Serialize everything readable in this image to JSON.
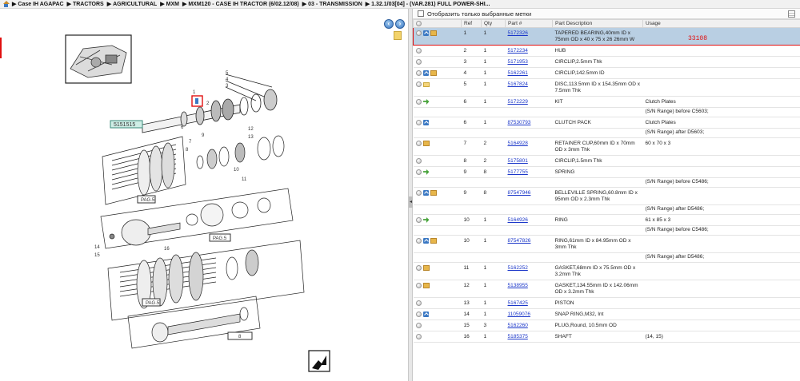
{
  "breadcrumb": {
    "items": [
      "Case IH AGAPAC",
      "TRACTORS",
      "AGRICULTURAL",
      "MXM",
      "MXM120 - CASE IH TRACTOR (6/02.12/08)",
      "03 - TRANSMISSION",
      "1.32.1/03[04] - (VAR.281) FULL POWER-SHI..."
    ],
    "separator": "▶"
  },
  "diagram": {
    "callout_label": "5151515",
    "page_labels": [
      "PAG.5",
      "PAG.5",
      "PAG.5"
    ],
    "bottom_label": "8",
    "numbers": [
      "1",
      "2",
      "3",
      "4",
      "5",
      "6",
      "7",
      "8",
      "9",
      "10",
      "11",
      "12",
      "13",
      "14",
      "15",
      "16"
    ]
  },
  "filter": {
    "label": "Отобразить только выбранные метки",
    "checked": false
  },
  "table": {
    "headers": [
      "",
      "Ref",
      "Qty",
      "Part #",
      "Part Description",
      "Usage"
    ],
    "highlight_code": "33108",
    "rows": [
      {
        "icons": [
          "info",
          "box"
        ],
        "ref": "1",
        "qty": "1",
        "part": "5172326",
        "desc": "TAPERED BEARING,40mm ID x 75mm OD x 40 x 75 x 26 26mm W",
        "usage": "",
        "selected": true
      },
      {
        "icons": [],
        "ref": "2",
        "qty": "1",
        "part": "5172234",
        "desc": "HUB",
        "usage": ""
      },
      {
        "icons": [],
        "ref": "3",
        "qty": "1",
        "part": "5171953",
        "desc": "CIRCLIP,2.5mm Thk",
        "usage": ""
      },
      {
        "icons": [
          "info",
          "box"
        ],
        "ref": "4",
        "qty": "1",
        "part": "5162261",
        "desc": "CIRCLIP,142.5mm ID",
        "usage": ""
      },
      {
        "icons": [
          "folder"
        ],
        "ref": "5",
        "qty": "1",
        "part": "5167824",
        "desc": "DISC,113.5mm ID x 154.35mm OD x 7.5mm Thk",
        "usage": ""
      },
      {
        "icons": [
          "arrow"
        ],
        "ref": "6",
        "qty": "1",
        "part": "5172229",
        "desc": "KIT",
        "usage": "Clutch Plates"
      },
      {
        "sub": true,
        "usage": "(S/N Range) before C5603;"
      },
      {
        "icons": [
          "info"
        ],
        "ref": "6",
        "qty": "1",
        "part": "87530793",
        "desc": "CLUTCH PACK",
        "usage": "Clutch Plates"
      },
      {
        "sub": true,
        "usage": "(S/N Range) after D5603;"
      },
      {
        "icons": [
          "box"
        ],
        "ref": "7",
        "qty": "2",
        "part": "5164928",
        "desc": "RETAINER CUP,60mm ID x 70mm OD x 3mm Thk",
        "usage": "60 x 70 x 3"
      },
      {
        "icons": [],
        "ref": "8",
        "qty": "2",
        "part": "5175801",
        "desc": "CIRCLIP,1.5mm Thk",
        "usage": ""
      },
      {
        "icons": [
          "arrow"
        ],
        "ref": "9",
        "qty": "8",
        "part": "5177755",
        "desc": "SPRING",
        "usage": ""
      },
      {
        "sub": true,
        "usage": "(S/N Range) before C5486;"
      },
      {
        "icons": [
          "info",
          "box"
        ],
        "ref": "9",
        "qty": "8",
        "part": "87547946",
        "desc": "BELLEVILLE SPRING,60.8mm ID x 95mm OD x 2.3mm Thk",
        "usage": ""
      },
      {
        "sub": true,
        "usage": "(S/N Range) after D5486;"
      },
      {
        "icons": [
          "arrow"
        ],
        "ref": "10",
        "qty": "1",
        "part": "5164926",
        "desc": "RING",
        "usage": "61 x 85 x 3"
      },
      {
        "sub": true,
        "usage": "(S/N Range) before C5486;"
      },
      {
        "icons": [
          "info",
          "box"
        ],
        "ref": "10",
        "qty": "1",
        "part": "87547826",
        "desc": "RING,61mm ID x 84.95mm OD x 3mm Thk",
        "usage": ""
      },
      {
        "sub": true,
        "usage": "(S/N Range) after D5486;"
      },
      {
        "icons": [
          "box"
        ],
        "ref": "11",
        "qty": "1",
        "part": "5162252",
        "desc": "GASKET,68mm ID x 75.5mm OD x 3.2mm Thk",
        "usage": ""
      },
      {
        "icons": [
          "box"
        ],
        "ref": "12",
        "qty": "1",
        "part": "5138955",
        "desc": "GASKET,134.55mm ID x 142.06mm OD x 3.2mm Thk",
        "usage": ""
      },
      {
        "icons": [],
        "ref": "13",
        "qty": "1",
        "part": "5167425",
        "desc": "PISTON",
        "usage": ""
      },
      {
        "icons": [
          "info"
        ],
        "ref": "14",
        "qty": "1",
        "part": "11059076",
        "desc": "SNAP RING,M32, Int",
        "usage": ""
      },
      {
        "icons": [],
        "ref": "15",
        "qty": "3",
        "part": "5162260",
        "desc": "PLUG,Round, 10.5mm OD",
        "usage": ""
      },
      {
        "icons": [],
        "ref": "16",
        "qty": "1",
        "part": "5185375",
        "desc": "SHAFT",
        "usage": "(14, 15)"
      }
    ]
  }
}
